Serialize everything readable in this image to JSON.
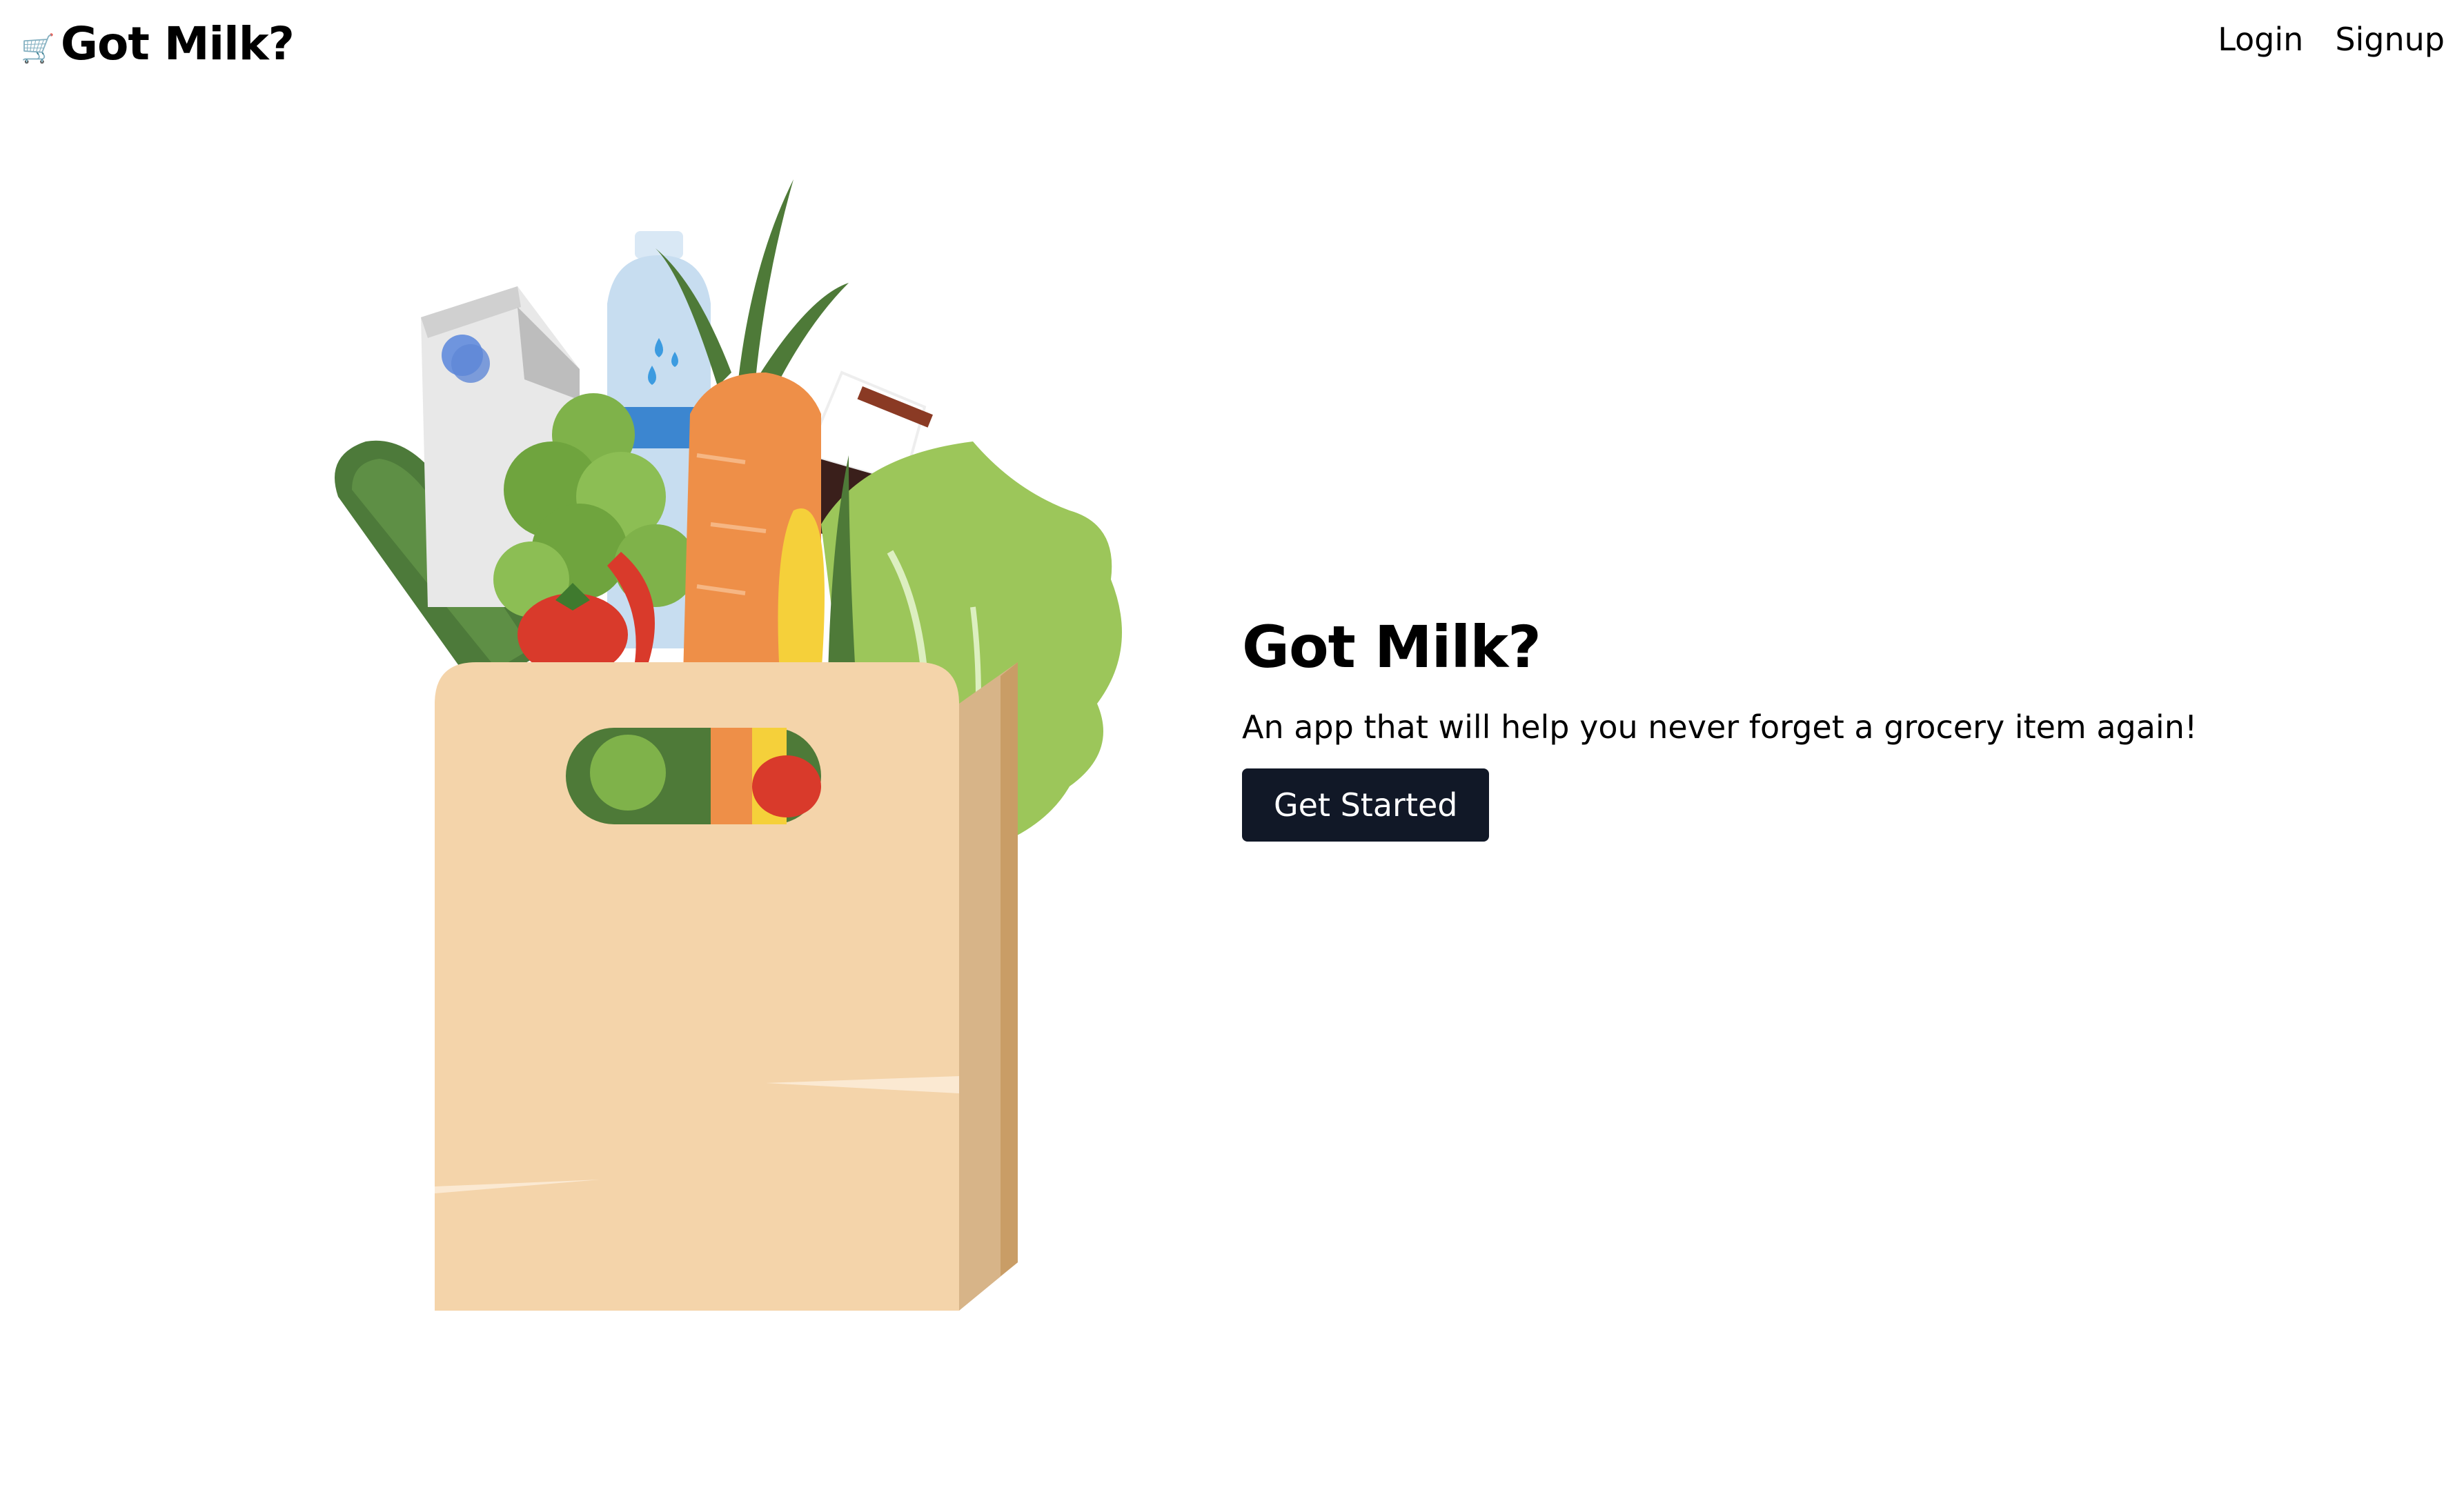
{
  "navbar": {
    "brand": {
      "icon": "shopping-cart-icon",
      "text": "Got Milk?"
    },
    "links": [
      {
        "label": "Login"
      },
      {
        "label": "Signup"
      }
    ]
  },
  "hero": {
    "title": "Got Milk?",
    "subtitle": "An app that will help you never forget a grocery item again!",
    "cta_label": "Get Started",
    "cta_color": "#111827"
  },
  "illustration": {
    "icon": "grocery-bag-illustration",
    "colors": {
      "bag_front": "#F4D4AA",
      "bag_side": "#D7B488",
      "carrot": "#EE8F48",
      "lettuce": "#9CC65A",
      "cucumber": "#4D7A3A",
      "tomato": "#D93A2B",
      "milk_carton": "#E8E8E8",
      "water_bottle": "#C7DDF0"
    }
  }
}
